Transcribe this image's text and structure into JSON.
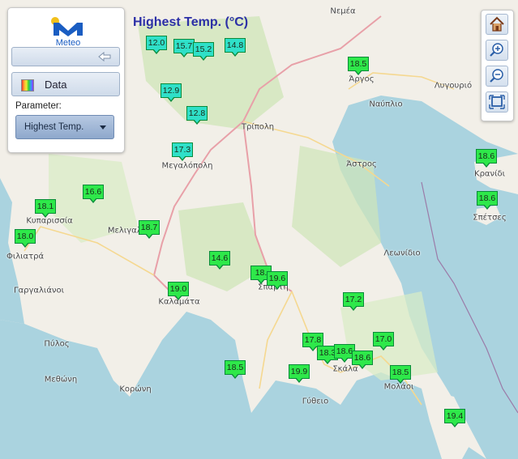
{
  "title": "Highest Temp. (°C)",
  "panel": {
    "logo_text": "Meteo",
    "data_label": "Data",
    "parameter_label": "Parameter:",
    "parameter_value": "Highest Temp."
  },
  "controls": {
    "home_icon": "home-icon",
    "zoom_in_icon": "zoom-in-icon",
    "zoom_out_icon": "zoom-out-icon",
    "zoom_extent_icon": "zoom-extent-icon"
  },
  "colors": {
    "title": "#2b2fa6",
    "marker_cool": "#2fe0c8",
    "marker_warm": "#2ee84a",
    "sea": "#aad3df",
    "land": "#f2efe8"
  },
  "towns": [
    "Νεμέα",
    "Άργος",
    "Λυγουριό",
    "Ναύπλιο",
    "Τρίπολη",
    "Μεγαλόπολη",
    "Άστρος",
    "Κρανίδι",
    "Σπέτσες",
    "Κυπαρισσία",
    "Μελιγαλάς",
    "Φιλιατρά",
    "Λεωνίδιο",
    "Γαργαλιάνοι",
    "Καλαμάτα",
    "Σπάρτη",
    "Πύλος",
    "Σκάλα",
    "Μεθώνη",
    "Κορώνη",
    "Μολάοι",
    "Γύθειο"
  ],
  "stations": [
    "12.0",
    "15.7",
    "15.2",
    "14.8",
    "18.5",
    "12.9",
    "12.8",
    "17.3",
    "18.6",
    "18.6",
    "16.6",
    "18.1",
    "18.0",
    "18.7",
    "14.6",
    "18.",
    "19.6",
    "19.0",
    "17.2",
    "17.8",
    "18.3",
    "18.6",
    "18.6",
    "17.0",
    "18.5",
    "19.9",
    "18.5",
    "19.4"
  ]
}
